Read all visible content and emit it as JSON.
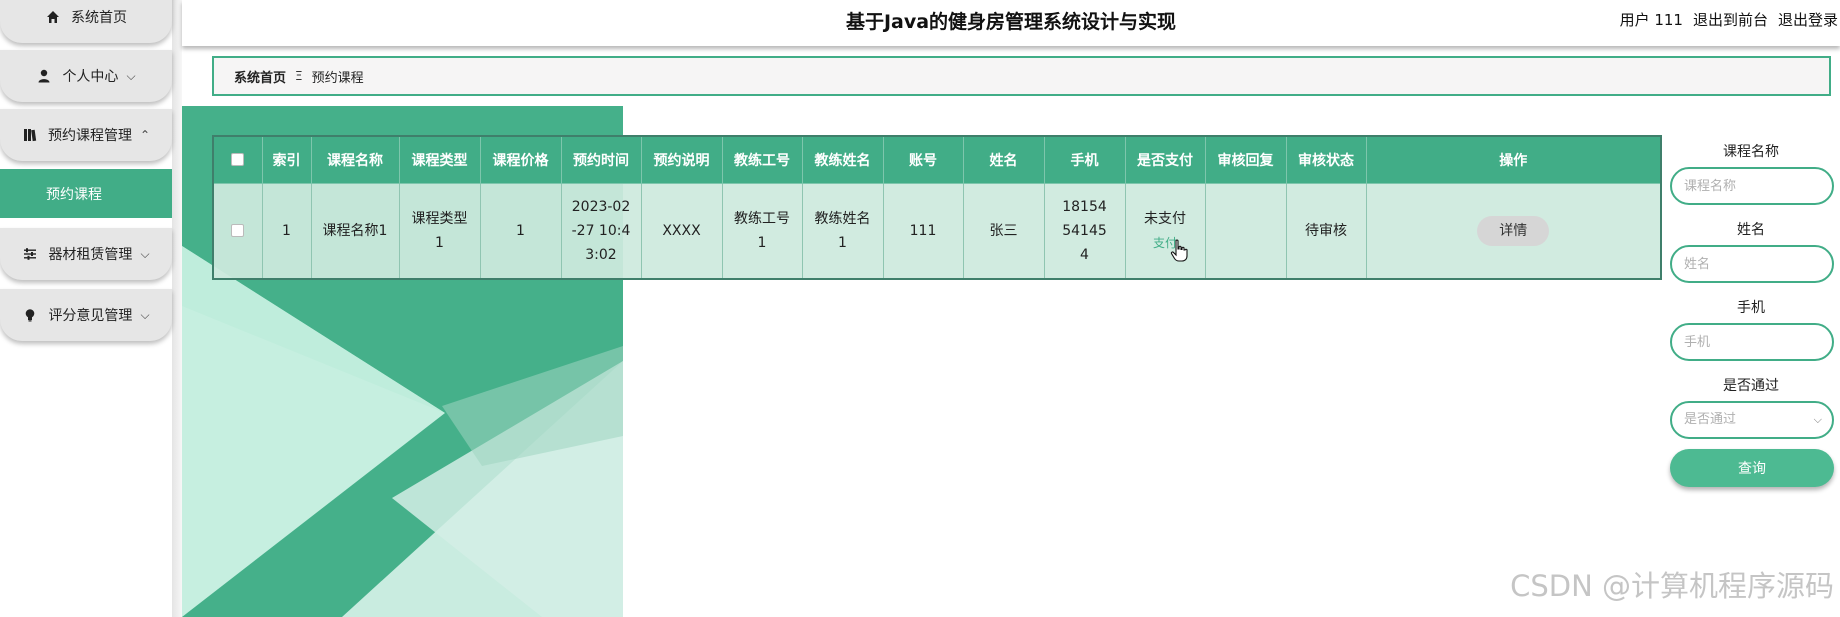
{
  "app": {
    "title": "基于Java的健身房管理系统设计与实现",
    "user_text": "用户 111",
    "to_front_label": "退出到前台",
    "logout_label": "退出登录"
  },
  "sidebar": {
    "items": [
      {
        "label": "系统首页",
        "icon": "home-icon"
      },
      {
        "label": "个人中心",
        "icon": "user-icon"
      },
      {
        "label": "预约课程管理",
        "icon": "book-icon"
      },
      {
        "label": "预约课程",
        "icon": ""
      },
      {
        "label": "器材租赁管理",
        "icon": "sliders-icon"
      },
      {
        "label": "评分意见管理",
        "icon": "bulb-icon"
      }
    ]
  },
  "breadcrumb": {
    "home": "系统首页",
    "separator": "Ξ",
    "current": "预约课程"
  },
  "table": {
    "headers": [
      "索引",
      "课程名称",
      "课程类型",
      "课程价格",
      "预约时间",
      "预约说明",
      "教练工号",
      "教练姓名",
      "账号",
      "姓名",
      "手机",
      "是否支付",
      "审核回复",
      "审核状态",
      "操作"
    ],
    "rows": [
      {
        "index": "1",
        "course_name": "课程名称1",
        "course_type": "课程类型1",
        "price": "1",
        "time": "2023-02-27 10:43:02",
        "desc": "XXXX",
        "coach_id": "教练工号1",
        "coach_name": "教练姓名1",
        "account": "111",
        "name": "张三",
        "phone": "18154541454",
        "paid": "未支付",
        "pay_link": "支付",
        "reply": "",
        "status": "待审核",
        "detail_label": "详情"
      }
    ]
  },
  "search": {
    "course_name_label": "课程名称",
    "course_name_placeholder": "课程名称",
    "name_label": "姓名",
    "name_placeholder": "姓名",
    "phone_label": "手机",
    "phone_placeholder": "手机",
    "passed_label": "是否通过",
    "passed_placeholder": "是否通过",
    "button_label": "查询"
  },
  "watermark": "CSDN @计算机程序源码",
  "colors": {
    "accent": "#41ad87",
    "button": "#4dba92",
    "row_bg": "#ceeade"
  }
}
